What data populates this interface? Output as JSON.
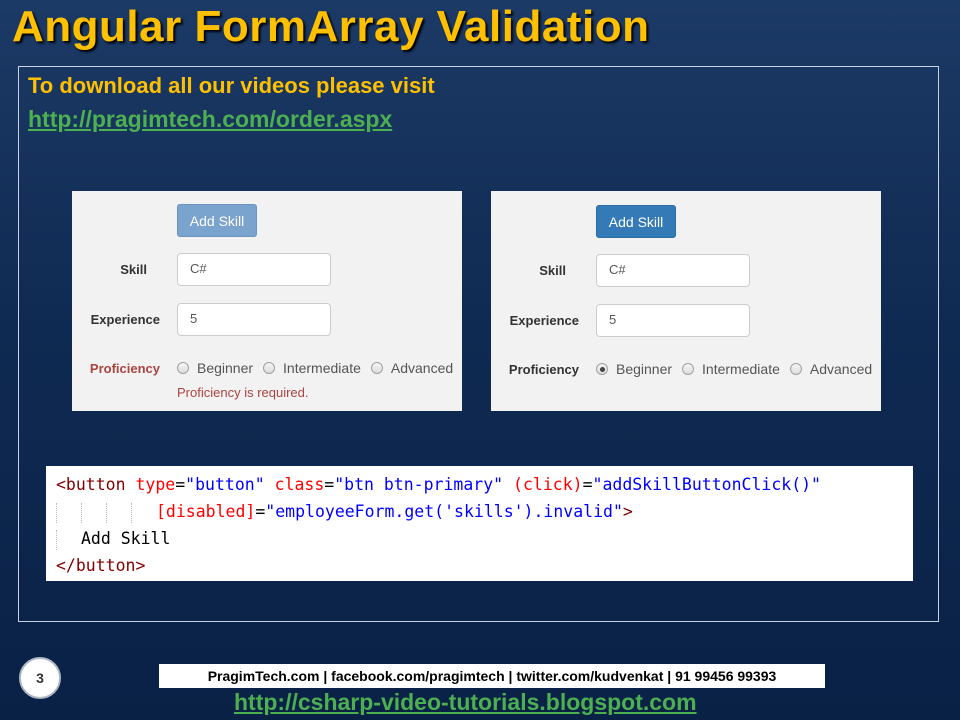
{
  "slide": {
    "title": "Angular FormArray Validation",
    "promo_text": "To download all our videos please visit",
    "promo_link": "http://pragimtech.com/order.aspx",
    "slide_number": "3",
    "footer_text": "PragimTech.com | facebook.com/pragimtech  | twitter.com/kudvenkat  | 91 99456 99393",
    "footer_link": "http://csharp-video-tutorials.blogspot.com"
  },
  "left_form": {
    "button_label": "Add Skill",
    "skill_label": "Skill",
    "skill_value": "C#",
    "experience_label": "Experience",
    "experience_value": "5",
    "proficiency_label": "Proficiency",
    "options": [
      "Beginner",
      "Intermediate",
      "Advanced"
    ],
    "error": "Proficiency is required."
  },
  "right_form": {
    "button_label": "Add Skill",
    "skill_label": "Skill",
    "skill_value": "C#",
    "experience_label": "Experience",
    "experience_value": "5",
    "proficiency_label": "Proficiency",
    "options": [
      "Beginner",
      "Intermediate",
      "Advanced"
    ],
    "selected": "Beginner"
  },
  "code": {
    "l1_open": "<button",
    "l1_attr1": "type",
    "l1_val1": "\"button\"",
    "l1_attr2": "class",
    "l1_val2": "\"btn btn-primary\"",
    "l1_attr3": "(click)",
    "l1_val3": "\"addSkillButtonClick()\"",
    "l2_attr": "[disabled]",
    "l2_val": "\"employeeForm.get('skills').invalid\"",
    "l2_close": ">",
    "l3_text": "Add Skill",
    "l4_close": "</button>"
  },
  "colors": {
    "title": "#ffc000",
    "link": "#4caf50",
    "primary_button": "#337ab7",
    "error": "#a94442"
  }
}
